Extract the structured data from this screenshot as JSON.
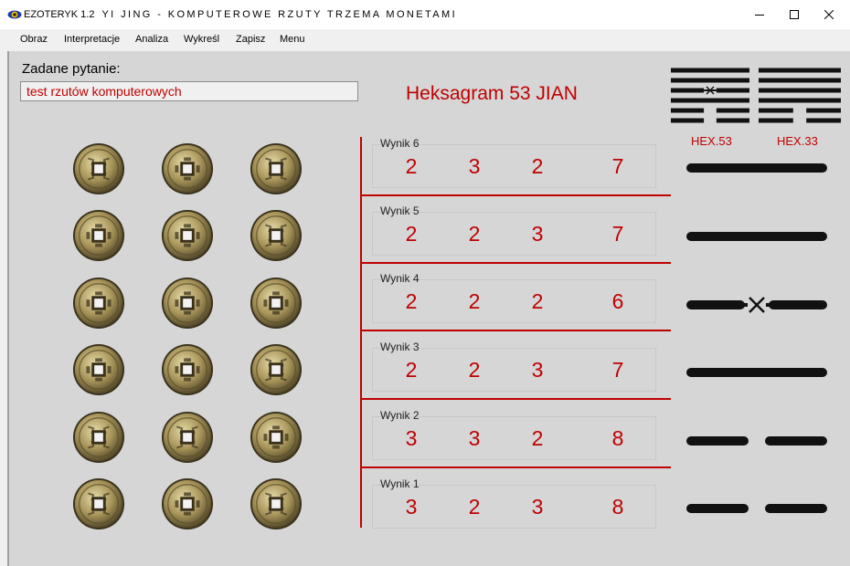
{
  "window": {
    "app_name": "EZOTERYK 1.2",
    "title": "YI JING - KOMPUTEROWE RZUTY TRZEMA MONETAMI"
  },
  "menu": {
    "items": [
      "Obraz",
      "Interpretacje",
      "Analiza",
      "Wykreśl",
      "Zapisz",
      "Menu"
    ]
  },
  "question": {
    "label": "Zadane pytanie:",
    "value": "test rzutów komputerowych"
  },
  "hexagram": {
    "title": "Heksagram 53 JIAN",
    "primary_label": "HEX.53",
    "secondary_label": "HEX.33"
  },
  "results": [
    {
      "label": "Wynik 6",
      "coins": [
        "2",
        "3",
        "2"
      ],
      "sum": "7",
      "line": "yang",
      "changing": false
    },
    {
      "label": "Wynik 5",
      "coins": [
        "2",
        "2",
        "3"
      ],
      "sum": "7",
      "line": "yang",
      "changing": false
    },
    {
      "label": "Wynik 4",
      "coins": [
        "2",
        "2",
        "2"
      ],
      "sum": "6",
      "line": "yin",
      "changing": true
    },
    {
      "label": "Wynik 3",
      "coins": [
        "2",
        "2",
        "3"
      ],
      "sum": "7",
      "line": "yang",
      "changing": false
    },
    {
      "label": "Wynik 2",
      "coins": [
        "3",
        "3",
        "2"
      ],
      "sum": "8",
      "line": "yin",
      "changing": false
    },
    {
      "label": "Wynik 1",
      "coins": [
        "3",
        "2",
        "3"
      ],
      "sum": "8",
      "line": "yin",
      "changing": false
    }
  ],
  "coins": {
    "rows": [
      [
        "tails",
        "heads",
        "tails"
      ],
      [
        "heads",
        "heads",
        "tails"
      ],
      [
        "heads",
        "heads",
        "heads"
      ],
      [
        "heads",
        "heads",
        "tails"
      ],
      [
        "tails",
        "tails",
        "heads"
      ],
      [
        "tails",
        "heads",
        "tails"
      ]
    ]
  },
  "colors": {
    "accent": "#c00000",
    "line": "#111111"
  }
}
